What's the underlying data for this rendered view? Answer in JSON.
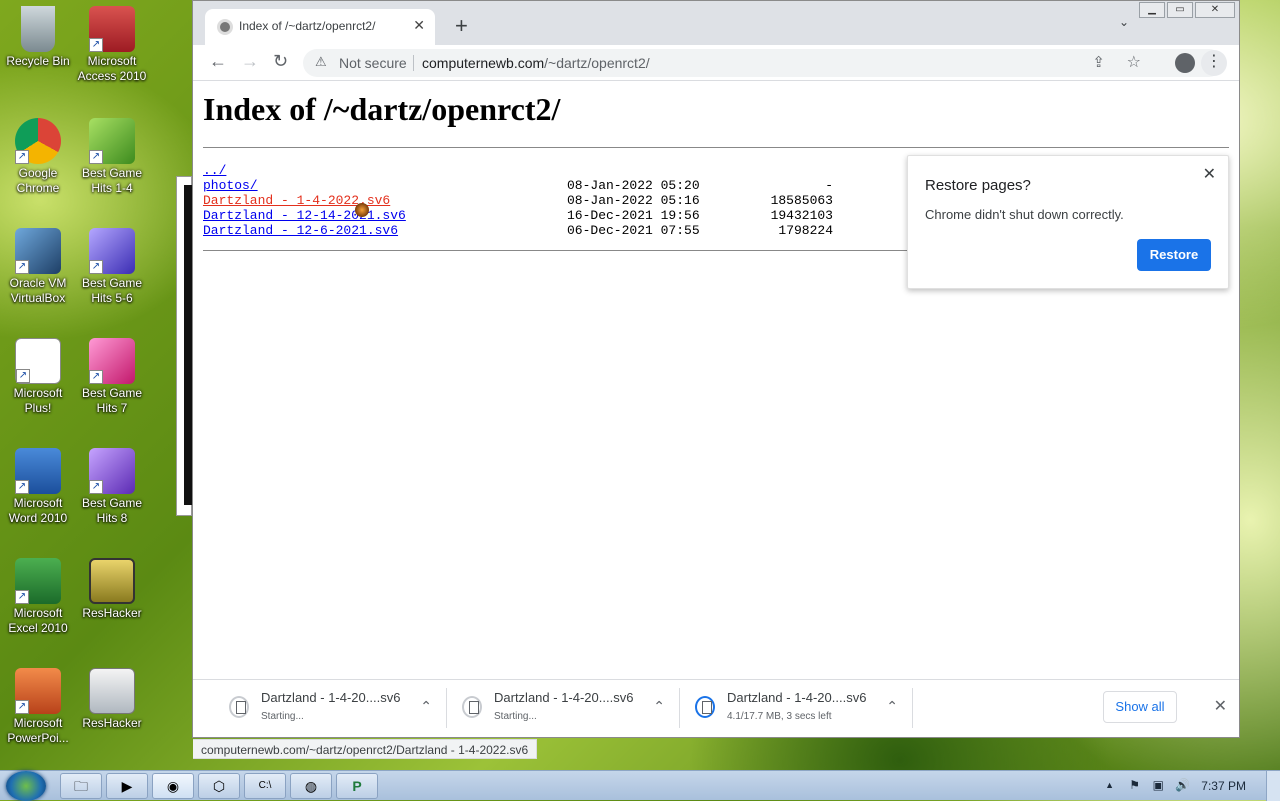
{
  "desktop": {
    "icons": [
      {
        "label": "Recycle Bin"
      },
      {
        "label": "Microsoft Access 2010"
      },
      {
        "label": "Google Chrome"
      },
      {
        "label": "Best Game Hits 1-4"
      },
      {
        "label": "Oracle VM VirtualBox"
      },
      {
        "label": "Best Game Hits 5-6"
      },
      {
        "label": "Microsoft Plus!"
      },
      {
        "label": "Best Game Hits 7"
      },
      {
        "label": "Microsoft Word 2010"
      },
      {
        "label": "Best Game Hits 8"
      },
      {
        "label": "Microsoft Excel 2010"
      },
      {
        "label": "ResHacker"
      },
      {
        "label": "Microsoft PowerPoi..."
      },
      {
        "label": "ResHacker"
      }
    ]
  },
  "browser": {
    "tab": {
      "title": "Index of /~dartz/openrct2/",
      "close": "✕"
    },
    "new_tab": "+",
    "tab_search": "⌄",
    "window_buttons": {
      "minimize": "▁",
      "maximize": "▭",
      "close": "✕"
    },
    "toolbar": {
      "back": "←",
      "forward": "→",
      "reload": "↻",
      "security_icon": "⚠",
      "not_secure": "Not secure",
      "url_host": "computernewb.com",
      "url_path": "/~dartz/openrct2/",
      "share": "⇪",
      "bookmark": "☆",
      "menu": "⋮"
    },
    "page": {
      "heading": "Index of /~dartz/openrct2/",
      "entries": [
        {
          "name": "../",
          "date": "",
          "size": ""
        },
        {
          "name": "photos/",
          "date": "08-Jan-2022 05:20",
          "size": "-"
        },
        {
          "name": "Dartzland - 1-4-2022.sv6",
          "date": "08-Jan-2022 05:16",
          "size": "18585063"
        },
        {
          "name": "Dartzland - 12-14-2021.sv6",
          "date": "16-Dec-2021 19:56",
          "size": "19432103"
        },
        {
          "name": "Dartzland - 12-6-2021.sv6",
          "date": "06-Dec-2021 07:55",
          "size": "1798224"
        }
      ]
    },
    "restore_bubble": {
      "title": "Restore pages?",
      "text": "Chrome didn't shut down correctly.",
      "button": "Restore",
      "close": "✕"
    },
    "status_url": "computernewb.com/~dartz/openrct2/Dartzland - 1-4-2022.sv6",
    "downloads": [
      {
        "name": "Dartzland - 1-4-20....sv6",
        "status": "Starting...",
        "chevron": "⌃"
      },
      {
        "name": "Dartzland - 1-4-20....sv6",
        "status": "Starting...",
        "chevron": "⌃"
      },
      {
        "name": "Dartzland - 1-4-20....sv6",
        "status": "4.1/17.7 MB, 3 secs left",
        "chevron": "⌃"
      }
    ],
    "show_all": "Show all",
    "shelf_close": "✕"
  },
  "taskbar": {
    "buttons": [
      {
        "icon": "folder-icon",
        "glyph": "🗀"
      },
      {
        "icon": "media-player-icon",
        "glyph": "▶"
      },
      {
        "icon": "chrome-icon",
        "glyph": "◉"
      },
      {
        "icon": "virtualbox-icon",
        "glyph": "⬡"
      },
      {
        "icon": "cmd-icon",
        "glyph": "C:\\"
      },
      {
        "icon": "globe-icon",
        "glyph": "◍"
      },
      {
        "icon": "publisher-icon",
        "glyph": "P"
      }
    ],
    "tray": {
      "up_arrow": "▲",
      "flag": "⚑",
      "network": "▣",
      "volume": "🔊"
    },
    "clock": "7:37 PM"
  }
}
